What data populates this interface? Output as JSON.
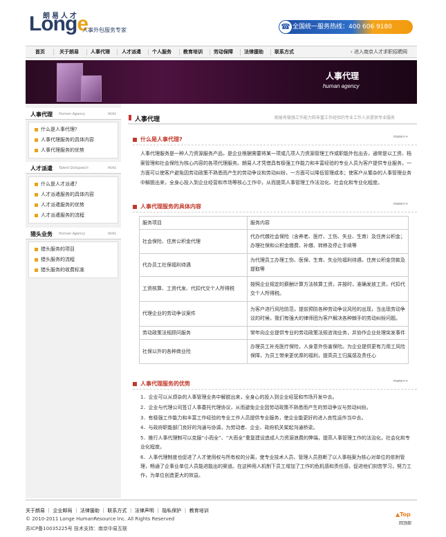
{
  "logo": {
    "top": "朗易人才",
    "word_prefix": "Long",
    "word_e": "e",
    "tagline": "人事外包服务专家"
  },
  "hotline": {
    "icon": "phone-icon",
    "text": "全国统一服务热线：400 606 9180"
  },
  "nav": {
    "items": [
      "首页",
      "关于朗易",
      "人事代理",
      "人才派遣",
      "个人服务",
      "教育培训",
      "劳动保障",
      "法律援助",
      "联系方式"
    ],
    "link": "进入南京人才求职招聘网"
  },
  "banner": {
    "title": "人事代理",
    "subtitle": "human agency"
  },
  "sidebar": {
    "sections": [
      {
        "title": "人事代理",
        "en": "Human Agency",
        "more": "MORE",
        "items": [
          "什么是人事代理?",
          "人事代理服务的具体内容",
          "人事代理服务的优势"
        ]
      },
      {
        "title": "人才派遣",
        "en": "Talent Dslispatch",
        "more": "MORE",
        "items": [
          "什么是人才派遣？",
          "人才派遣服务的具体内容",
          "人才派遣服务的优势",
          "人才派遣服务的流程"
        ]
      },
      {
        "title": "猎头业务",
        "en": "Human Agency",
        "more": "MORE",
        "items": [
          "猎头服务的项目",
          "猎头服务的流程",
          "猎头服务的收费标准"
        ]
      }
    ]
  },
  "main": {
    "title": "人事代理",
    "crumb": "朗易有极强工作能力和丰富工作经验的专业工作人员提供专业服务",
    "more": "more>>",
    "sec1": {
      "title": "什么是人事代理?",
      "para": "人事代理服务是一种人力资源服务产品，是企业根据需要将某一项或几项人力资源管理工作或职能外包出去，通常是以工资、档案管理和社会保险为核心内容的各项代理服务。朗易人才凭借具有极强工作能力和丰富经验的专业人员为客户提供专业服务，一方面可以使客户避免因劳动政策不熟悉而产生的劳动争议和劳动纠纷，一方面可以降低管理成本；使客户从繁杂的人事管理业务中解脱出来，全身心投入到企业经营和市场等核心工作中，从而提高人事管理工作法治化、社会化和专业化程度。"
    },
    "sec2": {
      "title": "人事代理服务的具体内容",
      "table": {
        "headers": [
          "服务项目",
          "服务内容"
        ],
        "rows": [
          [
            "社会保险、住房公积金代理",
            "代办代缴社会保险（含养老、医疗、工伤、失业、生育）及住房公积金；办理社保和公积金缴费、补缴、转移及停止手续等"
          ],
          [
            "代办员工社保福利待遇",
            "为代理员工办理工伤、医保、生育、失业险福利待遇，住房公积金贷款及提取等"
          ],
          [
            "工资核算、工资代发、代扣代交个人所得税",
            "按照企业规定的薪酬计算方法核算工资，并按时，准确发放工资，代扣代交个人所得税。"
          ],
          [
            "代理企业的劳动争议案件",
            "为客户进行风险防范，提前预防各种劳动争议风险的出现，当出现劳动争议的时候，我们有强大的律师团为客户解决各种棘手的劳动纠纷问题。"
          ],
          [
            "劳动政策法规顾问服务",
            "常年向企业提供专业的劳动政策法规咨询业务，并协作企业处理突发事件"
          ],
          [
            "社保以外的各种商业险",
            "办理员工补充医疗保险，人身意外伤害保险。为企业提供更有力用工风险保障，为员工带来更优厚的福利，提高员工归属感及责任心"
          ]
        ]
      }
    },
    "sec3": {
      "title": "人事代理服务的优势",
      "items": [
        "1．企业可以从烦杂的人事管理业务中解脱出来，全身心的投入到企业经营和市场开发中去。",
        "2．企业与代理公司签订人事委托代理协议，从而避免企业因劳动政策不熟悉而产生的劳动争议与劳动纠纷。",
        "3．有极强工作能力和丰富工作经验的专业工作人员提供专业服务，使企业能更好的进入良性运作当中去。",
        "4．与政府职能部门良好的沟通与协调，为劳动者、企业、政府机关架起沟通桥梁。",
        "5．推行人事代理制可以克服“小而全”、“大而全”重复建设造成人力资源浪费的弊端，提高人事管理工作的法治化，社会化和专业化程度。",
        "6．人事代理制度也促进了人才使用权与所有权的分离，使专业技术人员、管理人员割断了以人事档案为核心对单位的依附管理，畅通了企事业单位人员能进能出的渠道。在这种用人机制下员工增加了工作的危机感和责任感，促进他们刻苦学习，努力工作，为单位创造更大的效益。"
      ]
    }
  },
  "footer": {
    "links": "关于朗易 ｜ 企业邮局 ｜ 法律援助 ｜ 联系方式 ｜ 法律声明 ｜ 隐私保护 ｜ 教育培训",
    "copyright": "© 2010-2011 Longe HumanResource Inc. All Rights Reserved",
    "icp": "苏ICP备10035225号  技术支持：南京中易互联",
    "top": "Top",
    "top_label": "回顶部"
  }
}
